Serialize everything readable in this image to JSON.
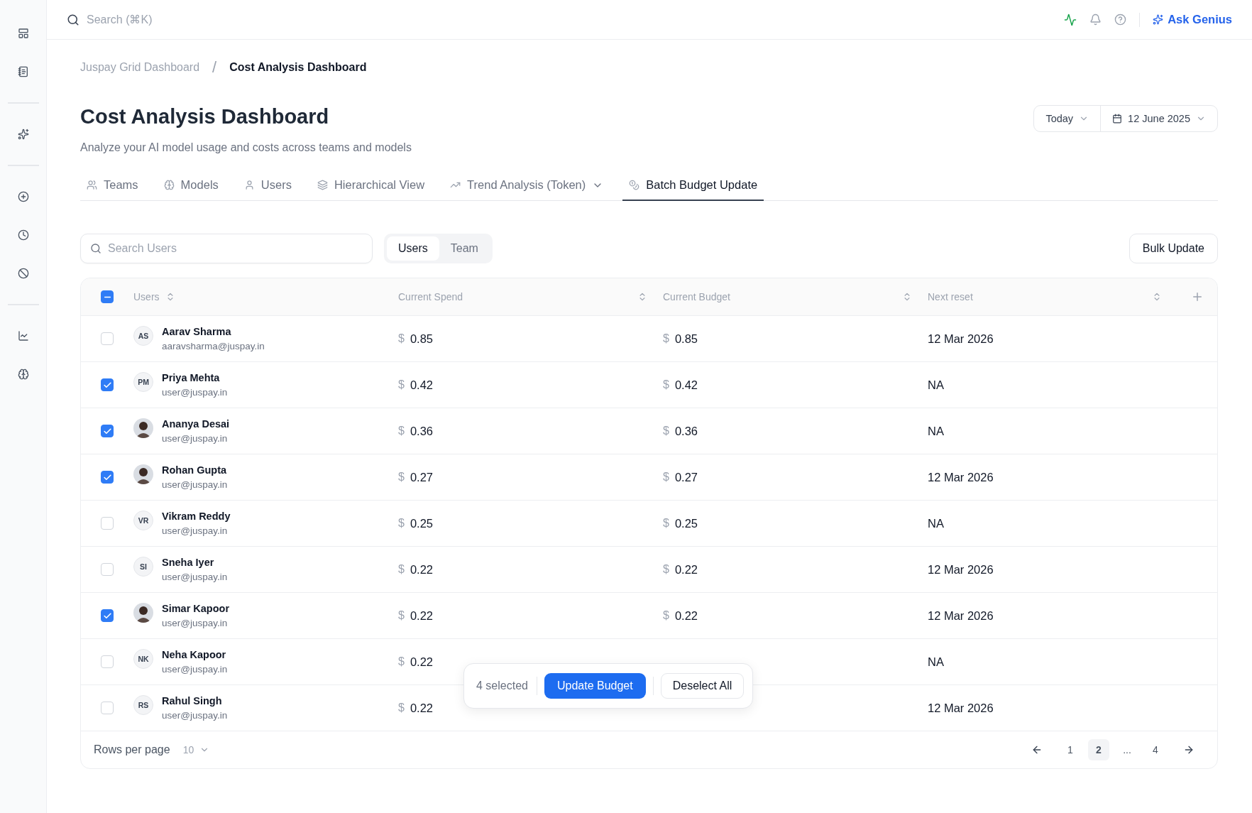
{
  "topbar": {
    "search_placeholder": "Search (⌘K)",
    "ask_label": "Ask Genius"
  },
  "breadcrumb": [
    "Juspay Grid Dashboard",
    "Cost Analysis Dashboard"
  ],
  "breadcrumb_separator": "/",
  "header": {
    "title": "Cost Analysis Dashboard",
    "subtitle": "Analyze your AI model usage and costs across teams and models",
    "range": "Today",
    "date": "12 June 2025"
  },
  "tabs": [
    {
      "label": "Teams",
      "kind": "teams",
      "selected": false
    },
    {
      "label": "Models",
      "kind": "models",
      "selected": false
    },
    {
      "label": "Users",
      "kind": "users",
      "selected": false
    },
    {
      "label": "Hierarchical View",
      "kind": "layers",
      "selected": false
    },
    {
      "label": "Trend Analysis (Token)",
      "kind": "trend",
      "selected": false,
      "dropdown": true
    },
    {
      "label": "Batch Budget Update",
      "kind": "coins",
      "selected": true
    }
  ],
  "search": {
    "placeholder": "Search Users"
  },
  "segments": [
    {
      "label": "Users",
      "selected": true
    },
    {
      "label": "Team",
      "selected": false
    }
  ],
  "bulk_button": "Bulk Update",
  "table": {
    "some_selected": true,
    "columns": [
      "Users",
      "Current Spend",
      "Current Budget",
      "Next reset"
    ],
    "currency": "$",
    "rows": [
      {
        "name": "Aarav Sharma",
        "email": "aaravsharma@juspay.in",
        "avatar": {
          "kind": "initials",
          "text": "AS"
        },
        "spend": "0.85",
        "budget": "0.85",
        "reset": "12 Mar 2026",
        "checked": false
      },
      {
        "name": "Priya Mehta",
        "email": "user@juspay.in",
        "avatar": {
          "kind": "initials",
          "text": "PM"
        },
        "spend": "0.42",
        "budget": "0.42",
        "reset": "NA",
        "checked": true
      },
      {
        "name": "Ananya Desai",
        "email": "user@juspay.in",
        "spend": "0.36",
        "budget": "0.36",
        "reset": "NA",
        "checked": true
      },
      {
        "name": "Rohan Gupta",
        "email": "user@juspay.in",
        "spend": "0.27",
        "budget": "0.27",
        "reset": "12 Mar 2026",
        "checked": true
      },
      {
        "name": "Vikram Reddy",
        "email": "user@juspay.in",
        "avatar": {
          "kind": "initials",
          "text": "VR"
        },
        "spend": "0.25",
        "budget": "0.25",
        "reset": "NA",
        "checked": false
      },
      {
        "name": "Sneha Iyer",
        "email": "user@juspay.in",
        "avatar": {
          "kind": "initials",
          "text": "SI"
        },
        "spend": "0.22",
        "budget": "0.22",
        "reset": "12 Mar 2026",
        "checked": false
      },
      {
        "name": "Simar Kapoor",
        "email": "user@juspay.in",
        "spend": "0.22",
        "budget": "0.22",
        "reset": "12 Mar 2026",
        "checked": true
      },
      {
        "name": "Neha Kapoor",
        "email": "user@juspay.in",
        "avatar": {
          "kind": "initials",
          "text": "NK"
        },
        "spend": "0.22",
        "reset": "NA",
        "checked": false
      },
      {
        "name": "Rahul Singh",
        "email": "user@juspay.in",
        "avatar": {
          "kind": "initials",
          "text": "RS"
        },
        "spend": "0.22",
        "reset": "12 Mar 2026",
        "checked": false
      }
    ]
  },
  "footer": {
    "rows_label": "Rows per page",
    "rows_value": "10",
    "pages": [
      {
        "label": "1",
        "selected": false
      },
      {
        "label": "2",
        "selected": true
      },
      {
        "label": "...",
        "selected": false
      },
      {
        "label": "4",
        "selected": false
      }
    ]
  },
  "selection_bar": {
    "count": "4 selected",
    "primary": "Update Budget",
    "secondary": "Deselect All"
  }
}
